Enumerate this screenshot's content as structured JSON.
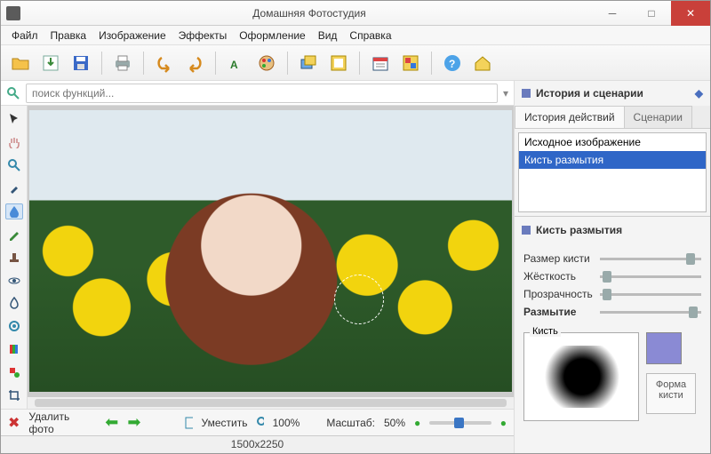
{
  "titlebar": {
    "title": "Домашняя Фотостудия"
  },
  "menu": [
    "Файл",
    "Правка",
    "Изображение",
    "Эффекты",
    "Оформление",
    "Вид",
    "Справка"
  ],
  "search": {
    "placeholder": "поиск функций..."
  },
  "bottombar": {
    "delete": "Удалить фото",
    "fit": "Уместить",
    "hundred": "100%",
    "scale_label": "Масштаб:",
    "scale_value": "50%"
  },
  "status": {
    "dims": "1500x2250"
  },
  "right": {
    "header": "История и сценарии",
    "tabs": {
      "history": "История действий",
      "scenarios": "Сценарии"
    },
    "history_items": [
      "Исходное изображение",
      "Кисть размытия"
    ],
    "panel_title": "Кисть размытия",
    "sliders": {
      "size": "Размер кисти",
      "hard": "Жёсткость",
      "opacity": "Прозрачность",
      "blur": "Размытие"
    },
    "brush_legend": "Кисть",
    "shape_btn": "Форма кисти"
  }
}
